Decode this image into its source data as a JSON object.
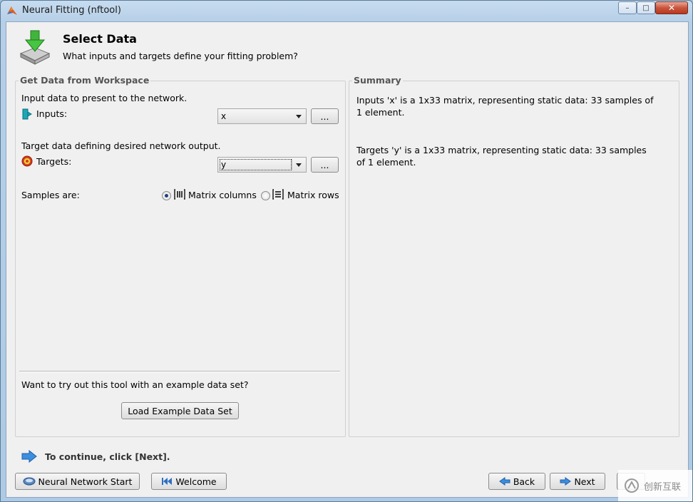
{
  "window": {
    "title": "Neural Fitting (nftool)",
    "controls": {
      "minimize": "–",
      "maximize": "□",
      "close": "✕"
    }
  },
  "header": {
    "title": "Select Data",
    "subtitle": "What inputs and targets define your fitting problem?"
  },
  "workspace_group": {
    "legend": "Get Data from Workspace",
    "input_desc": "Input data to present to the network.",
    "inputs_label": "Inputs:",
    "inputs_value": "x",
    "browse_label": "...",
    "target_desc": "Target data defining desired network output.",
    "targets_label": "Targets:",
    "targets_value": "y",
    "samples_label": "Samples are:",
    "option_columns": "Matrix columns",
    "option_rows": "Matrix rows",
    "selected_option": "Matrix columns",
    "example_prompt": "Want to try out this tool with an example data set?",
    "load_example_label": "Load Example Data Set"
  },
  "summary_group": {
    "legend": "Summary",
    "inputs_summary": "Inputs 'x' is a 1x33 matrix, representing static data: 33 samples of 1 element.",
    "targets_summary": "Targets 'y' is a 1x33 matrix, representing static data: 33 samples of 1 element."
  },
  "footer": {
    "continue_text": "To continue, click [Next].",
    "nn_start_label": "Neural Network Start",
    "welcome_label": "Welcome",
    "back_label": "Back",
    "next_label": "Next"
  },
  "watermark": {
    "text": "创新互联"
  },
  "colors": {
    "accent_blue": "#2f7fd8",
    "background": "#f0f0f0",
    "frame": "#aecae4"
  }
}
